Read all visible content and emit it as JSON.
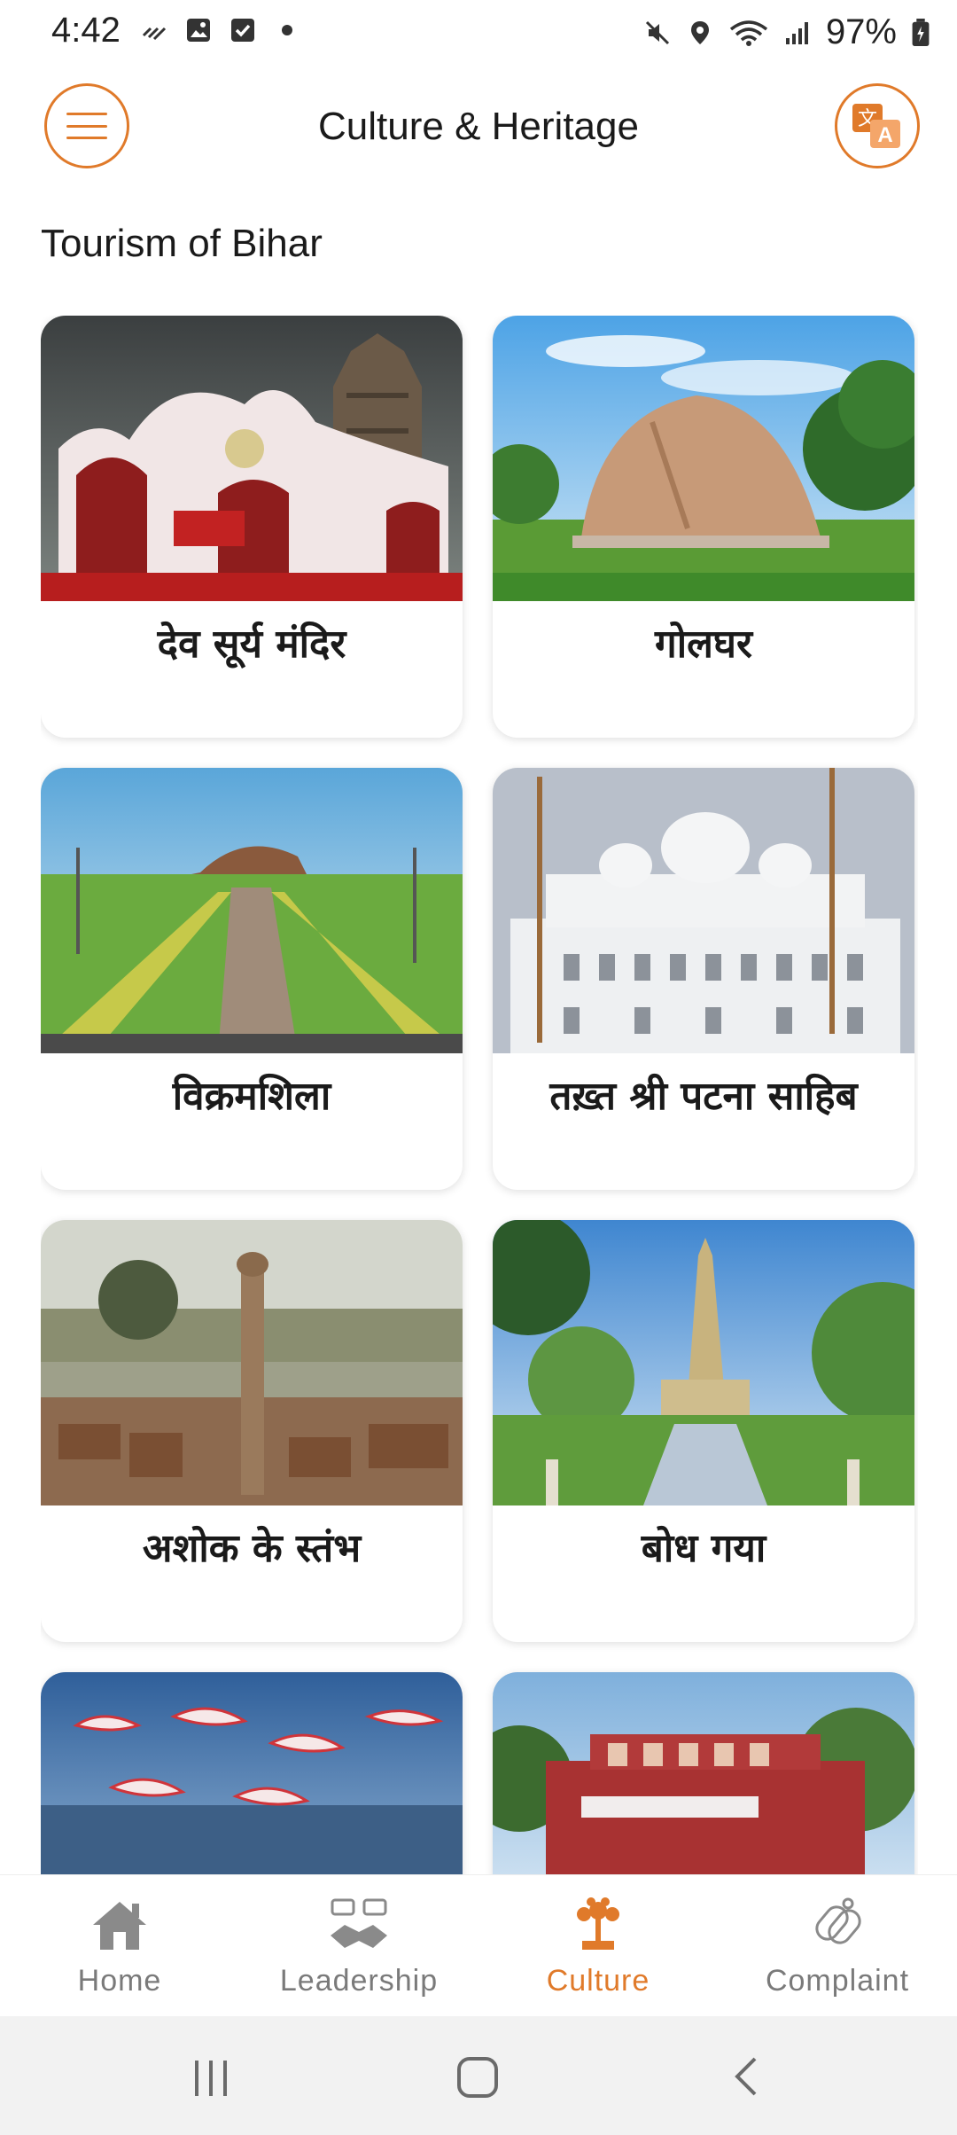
{
  "status_bar": {
    "time": "4:42",
    "battery": "97%",
    "icons": [
      "signal-scribble-icon",
      "gallery-icon",
      "checkbox-icon",
      "dot-icon",
      "mute-icon",
      "location-icon",
      "wifi-icon",
      "cell-signal-icon",
      "battery-icon"
    ]
  },
  "app_bar": {
    "title": "Culture & Heritage",
    "menu_icon": "hamburger-menu-icon",
    "translate_icon": "translate-icon"
  },
  "section": {
    "title": "Tourism of Bihar"
  },
  "cards": [
    {
      "label": "देव सूर्य मंदिर",
      "image": "deo-surya-temple-photo"
    },
    {
      "label": "गोलघर",
      "image": "golghar-photo"
    },
    {
      "label": "विक्रमशिला",
      "image": "vikramshila-photo"
    },
    {
      "label": "तख़्त श्री पटना साहिब",
      "image": "takht-sri-patna-sahib-photo"
    },
    {
      "label": "अशोक के स्तंभ",
      "image": "ashoka-pillar-photo"
    },
    {
      "label": "बोध गया",
      "image": "bodh-gaya-photo"
    },
    {
      "label": "",
      "image": "flamingos-photo"
    },
    {
      "label": "",
      "image": "red-building-photo"
    }
  ],
  "bottom_nav": {
    "items": [
      {
        "label": "Home",
        "icon": "home-icon"
      },
      {
        "label": "Leadership",
        "icon": "leadership-icon"
      },
      {
        "label": "Culture",
        "icon": "culture-icon"
      },
      {
        "label": "Complaint",
        "icon": "complaint-icon"
      }
    ],
    "active": "Culture",
    "accent_color": "#e07a2a"
  },
  "system_nav": {
    "icons": [
      "recents-icon",
      "home-circle-icon",
      "back-icon"
    ]
  }
}
